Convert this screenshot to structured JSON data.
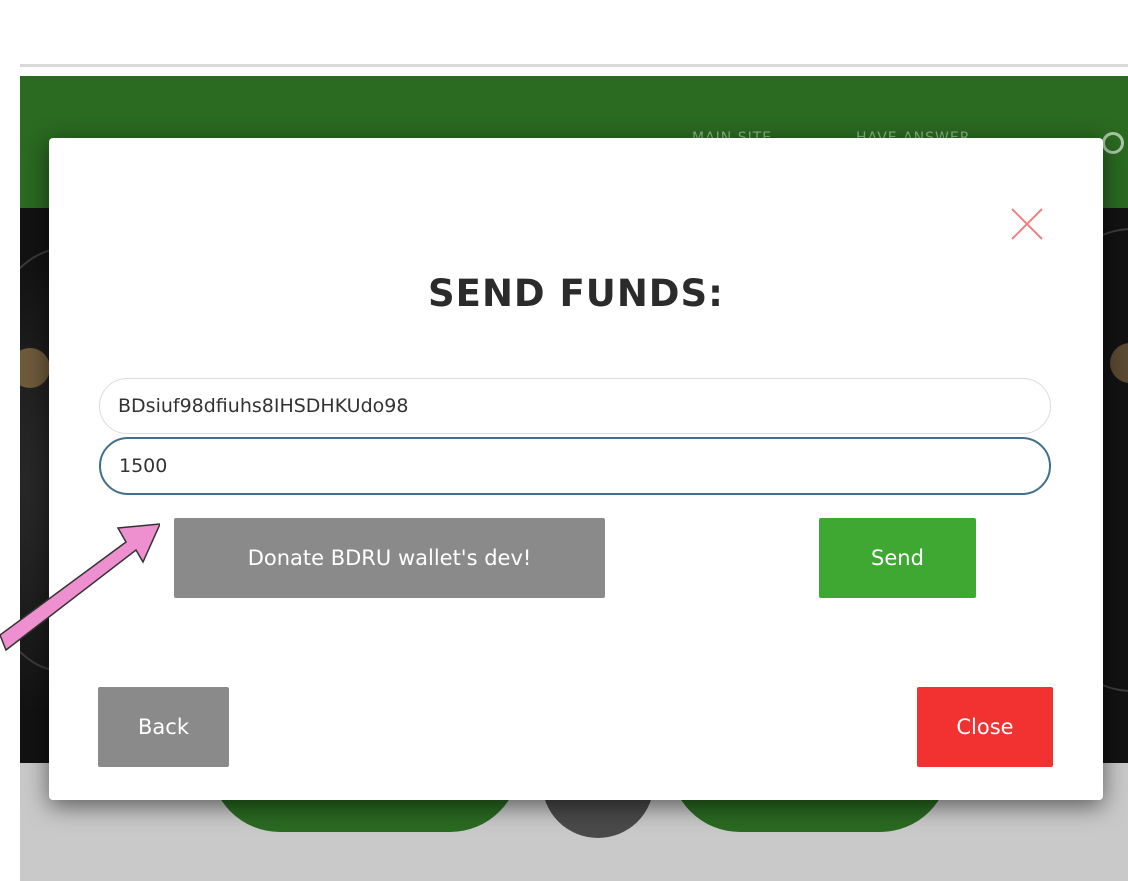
{
  "nav": {
    "main_site_label": "MAIN SITE",
    "have_answer_label": "HAVE ANSWER"
  },
  "modal": {
    "title": "SEND FUNDS:",
    "address_value": "BDsiuf98dfiuhs8IHSDHKUdo98",
    "amount_value": "1500",
    "donate_label": "Donate BDRU wallet's dev!",
    "send_label": "Send",
    "back_label": "Back",
    "close_label": "Close"
  },
  "colors": {
    "nav_green": "#2a6a21",
    "send_green": "#3ea832",
    "close_red": "#f23131",
    "neutral_gray": "#8a8a8a",
    "close_x": "#f08080",
    "annotation_arrow": "#ee8fcf"
  },
  "icons": {
    "close": "close-x-icon",
    "annotation": "pointer-arrow-icon"
  }
}
